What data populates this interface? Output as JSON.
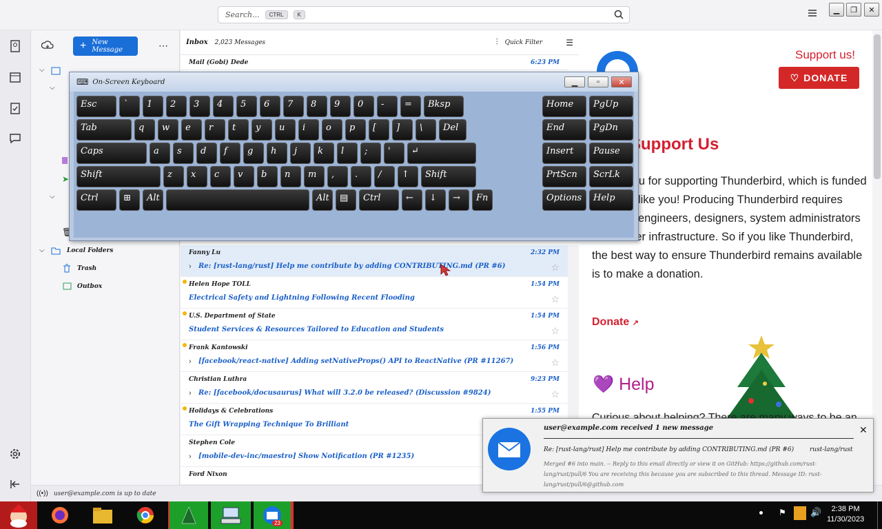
{
  "titlebar": {
    "search_placeholder": "Search...",
    "kbd1": "CTRL",
    "kbd2": "K"
  },
  "folder": {
    "new_message": "New Message",
    "local_folders": "Local Folders",
    "trash": "Trash",
    "outbox": "Outbox"
  },
  "list": {
    "label": "Inbox",
    "count": "2,023 Messages",
    "quick_filter": "Quick Filter"
  },
  "rows": [
    {
      "from": "Mail (Gobi) Dede",
      "subject": "",
      "date": "6:23 PM",
      "dot": false,
      "thread": false
    },
    {
      "from": "Fanny Lu",
      "subject": "Re: [rust-lang/rust] Help me contribute by adding CONTRIBUTING.md (PR #6)",
      "date": "2:32 PM",
      "dot": false,
      "thread": true,
      "selected": true
    },
    {
      "from": "Helen Hope TOLL",
      "subject": "Electrical Safety and Lightning Following Recent Flooding",
      "date": "1:54 PM",
      "dot": true,
      "thread": false
    },
    {
      "from": "U.S. Department of State",
      "subject": "Student Services & Resources Tailored to Education and Students",
      "date": "1:54 PM",
      "dot": true,
      "thread": false
    },
    {
      "from": "Frank Kantowski",
      "subject": "[facebook/react-native] Adding setNativeProps() API to ReactNative (PR #11267)",
      "date": "1:56 PM",
      "dot": true,
      "thread": true
    },
    {
      "from": "Christian Luthra",
      "subject": "Re: [facebook/docusaurus] What will 3.2.0 be released? (Discussion #9824)",
      "date": "9:23 PM",
      "dot": false,
      "thread": true
    },
    {
      "from": "Holidays & Celebrations",
      "subject": "The Gift Wrapping Technique To Brilliant",
      "date": "1:55 PM",
      "dot": true,
      "thread": false
    },
    {
      "from": "Stephen Cole",
      "subject": "[mobile-dev-inc/maestro] Show Notification (PR #1235)",
      "date": "",
      "dot": false,
      "thread": true
    },
    {
      "from": "Ford Nixon",
      "subject": "",
      "date": "",
      "dot": false,
      "thread": false
    }
  ],
  "osk": {
    "title": "On-Screen Keyboard",
    "rows": [
      [
        "Esc",
        "`",
        "1",
        "2",
        "3",
        "4",
        "5",
        "6",
        "7",
        "8",
        "9",
        "0",
        "-",
        "=",
        "Bksp",
        "Home",
        "PgUp"
      ],
      [
        "Tab",
        "q",
        "w",
        "e",
        "r",
        "t",
        "y",
        "u",
        "i",
        "o",
        "p",
        "[",
        "]",
        "\\",
        "Del",
        "End",
        "PgDn"
      ],
      [
        "Caps",
        "a",
        "s",
        "d",
        "f",
        "g",
        "h",
        "j",
        "k",
        "l",
        ";",
        "'",
        "↵",
        "Insert",
        "Pause"
      ],
      [
        "Shift",
        "z",
        "x",
        "c",
        "v",
        "b",
        "n",
        "m",
        ",",
        ".",
        "/",
        "↑",
        "Shift",
        "PrtScn",
        "ScrLk"
      ],
      [
        "Ctrl",
        "⊞",
        "Alt",
        "",
        "Alt",
        "▤",
        "Ctrl",
        "←",
        "↓",
        "→",
        "Fn",
        "Options",
        "Help"
      ]
    ]
  },
  "right": {
    "support_us": "Support us!",
    "donate_btn": "DONATE",
    "heading": "Support Us",
    "paragraph": "Thank you for supporting Thunderbird, which is funded by users like you! Producing Thunderbird requires software engineers, designers, system administrators and server infrastructure. So if you like Thunderbird, the best way to ensure Thunderbird remains available is to make a donation.",
    "donate_link": "Donate",
    "help": "Help",
    "curious": "Curious about helping? There are many ways to be an"
  },
  "status": {
    "text": "user@example.com is up to date"
  },
  "notification": {
    "title": "user@example.com received 1 new message",
    "subject": "Re: [rust-lang/rust] Help me contribute by adding CONTRIBUTING.md (PR #6)",
    "subject_meta": "rust-lang/rust",
    "body": "Merged #6 into main. -- Reply to this email directly or view it on GitHub: https://github.com/rust-lang/rust/pull/6 You are receiving this because you are subscribed to this thread. Message ID: rust-lang/rust/pull/6@github.com"
  },
  "clock": {
    "time": "2:38 PM",
    "date": "11/30/2023"
  },
  "taskbar": {
    "badge": "23"
  },
  "colors": {
    "accent": "#1a6ed8",
    "red": "#d32030",
    "help": "#b0208a"
  }
}
